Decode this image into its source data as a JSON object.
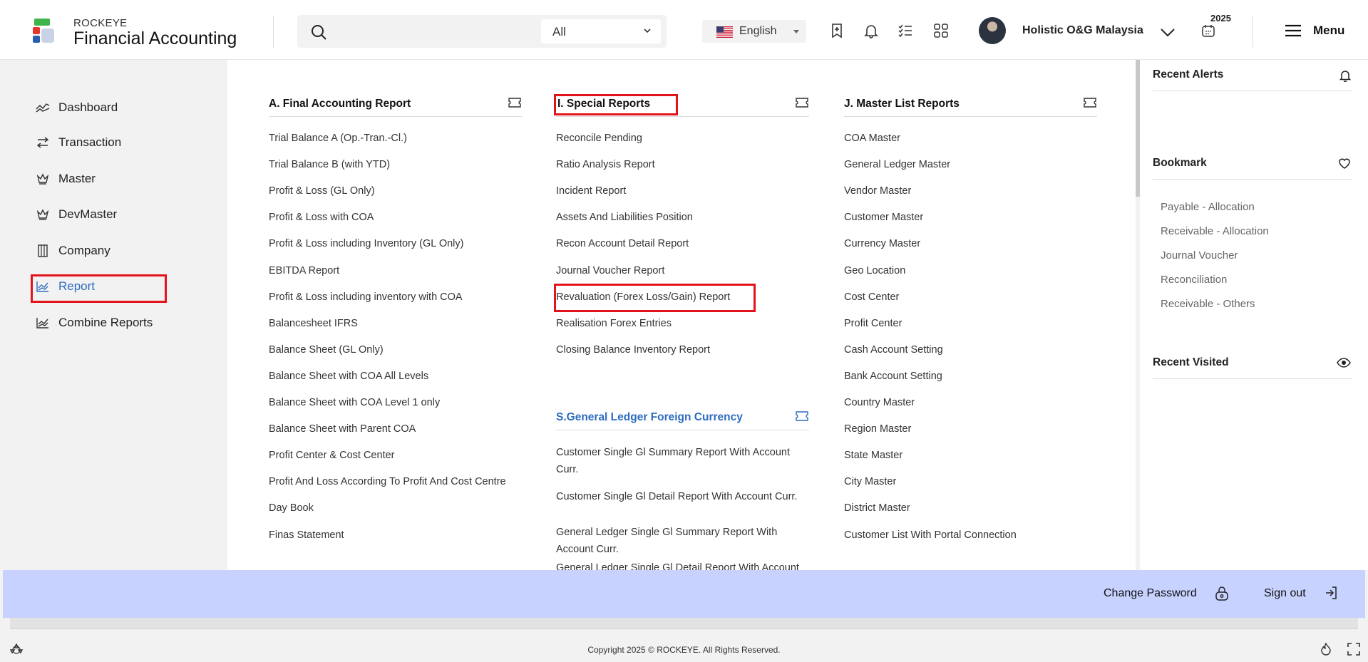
{
  "header": {
    "brand_small": "ROCKEYE",
    "brand_title": "Financial Accounting",
    "search": {
      "placeholder": "",
      "filter_value": "All"
    },
    "language": "English",
    "company": "Holistic O&G Malaysia",
    "year": "2025",
    "menu_label": "Menu"
  },
  "sidebar": {
    "items": [
      {
        "label": "Dashboard",
        "icon": "trend-icon"
      },
      {
        "label": "Transaction",
        "icon": "swap-arrows-icon"
      },
      {
        "label": "Master",
        "icon": "crown-icon"
      },
      {
        "label": "DevMaster",
        "icon": "crown-icon"
      },
      {
        "label": "Company",
        "icon": "building-icon"
      },
      {
        "label": "Report",
        "icon": "chart-icon",
        "active": true
      },
      {
        "label": "Combine Reports",
        "icon": "chart-icon"
      }
    ]
  },
  "reports": {
    "final_accounting": {
      "title": "A. Final Accounting Report",
      "items": [
        "Trial Balance A (Op.-Tran.-Cl.)",
        "Trial Balance B (with YTD)",
        "Profit & Loss (GL Only)",
        "Profit & Loss with COA",
        "Profit & Loss including Inventory (GL Only)",
        "EBITDA Report",
        "Profit & Loss including inventory with COA",
        "Balancesheet IFRS",
        "Balance Sheet (GL Only)",
        "Balance Sheet with COA All Levels",
        "Balance Sheet with COA Level 1 only",
        "Balance Sheet with Parent COA",
        "Profit Center & Cost Center",
        "Profit And Loss According To Profit And Cost Centre",
        "Day Book",
        "Finas Statement"
      ]
    },
    "special": {
      "title": "I. Special Reports",
      "items": [
        "Reconcile Pending",
        "Ratio Analysis Report",
        "Incident Report",
        "Assets And Liabilities Position",
        "Recon Account Detail Report",
        "Journal Voucher Report",
        "Revaluation (Forex Loss/Gain) Report",
        "Realisation Forex Entries",
        "Closing Balance Inventory Report"
      ]
    },
    "gl_foreign": {
      "title": "S.General Ledger Foreign Currency",
      "items": [
        "Customer Single Gl Summary Report With Account Curr.",
        "Customer Single Gl Detail Report With Account Curr.",
        "General Ledger Single Gl Summary Report With Account Curr.",
        "General Ledger Single Gl Detail Report With Account"
      ]
    },
    "master_list": {
      "title": "J. Master List Reports",
      "items": [
        "COA Master",
        "General Ledger Master",
        "Vendor Master",
        "Customer Master",
        "Currency Master",
        "Geo Location",
        "Cost Center",
        "Profit Center",
        "Cash Account Setting",
        "Bank Account Setting",
        "Country Master",
        "Region Master",
        "State Master",
        "City Master",
        "District Master",
        "Customer List With Portal Connection"
      ]
    }
  },
  "right_panel": {
    "recent_alerts": "Recent Alerts",
    "bookmark": "Bookmark",
    "bookmarks": [
      "Payable - Allocation",
      "Receivable - Allocation",
      "Journal Voucher",
      "Reconciliation",
      "Receivable - Others"
    ],
    "recent_visited": "Recent Visited"
  },
  "bottom_bar": {
    "change_password": "Change Password",
    "sign_out": "Sign out"
  },
  "footer": {
    "copyright": "Copyright 2025 © ROCKEYE. All Rights Reserved."
  },
  "colors": {
    "accent_blue": "#2d6cc0",
    "highlight_red": "#e3131b",
    "bottom_bar_bg": "#c7d2ff"
  }
}
